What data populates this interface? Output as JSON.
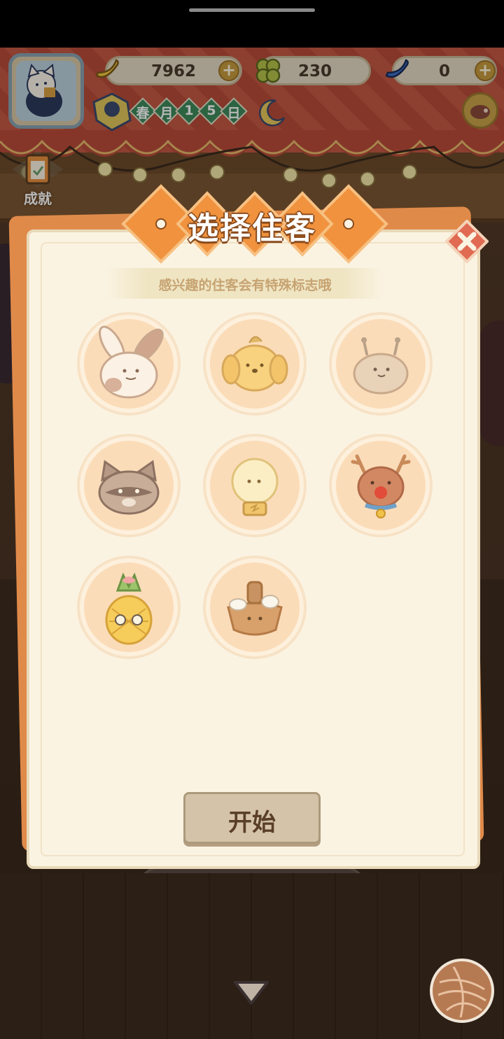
{
  "hud": {
    "banana_count": "7962",
    "clover_count": "230",
    "blue_banana_count": "0",
    "plus_symbol": "+",
    "date": [
      "春",
      "月",
      "1",
      "5",
      "日"
    ],
    "achievement_label": "成就"
  },
  "modal": {
    "title": "选择住客",
    "subtitle": "感兴趣的住客会有特殊标志哦",
    "start_label": "开始",
    "guests": [
      "bunny-guest-icon",
      "puppy-guest-icon",
      "snail-guest-icon",
      "raccoon-guest-icon",
      "lightbulb-guest-icon",
      "reindeer-guest-icon",
      "pineapple-guest-icon",
      "pudding-bowl-guest-icon"
    ]
  },
  "colors": {
    "accent_orange": "#f0923e",
    "panel_cream": "#fbf3e2",
    "awning_red": "#c0533f",
    "calendar_green": "#3e8a5b"
  }
}
